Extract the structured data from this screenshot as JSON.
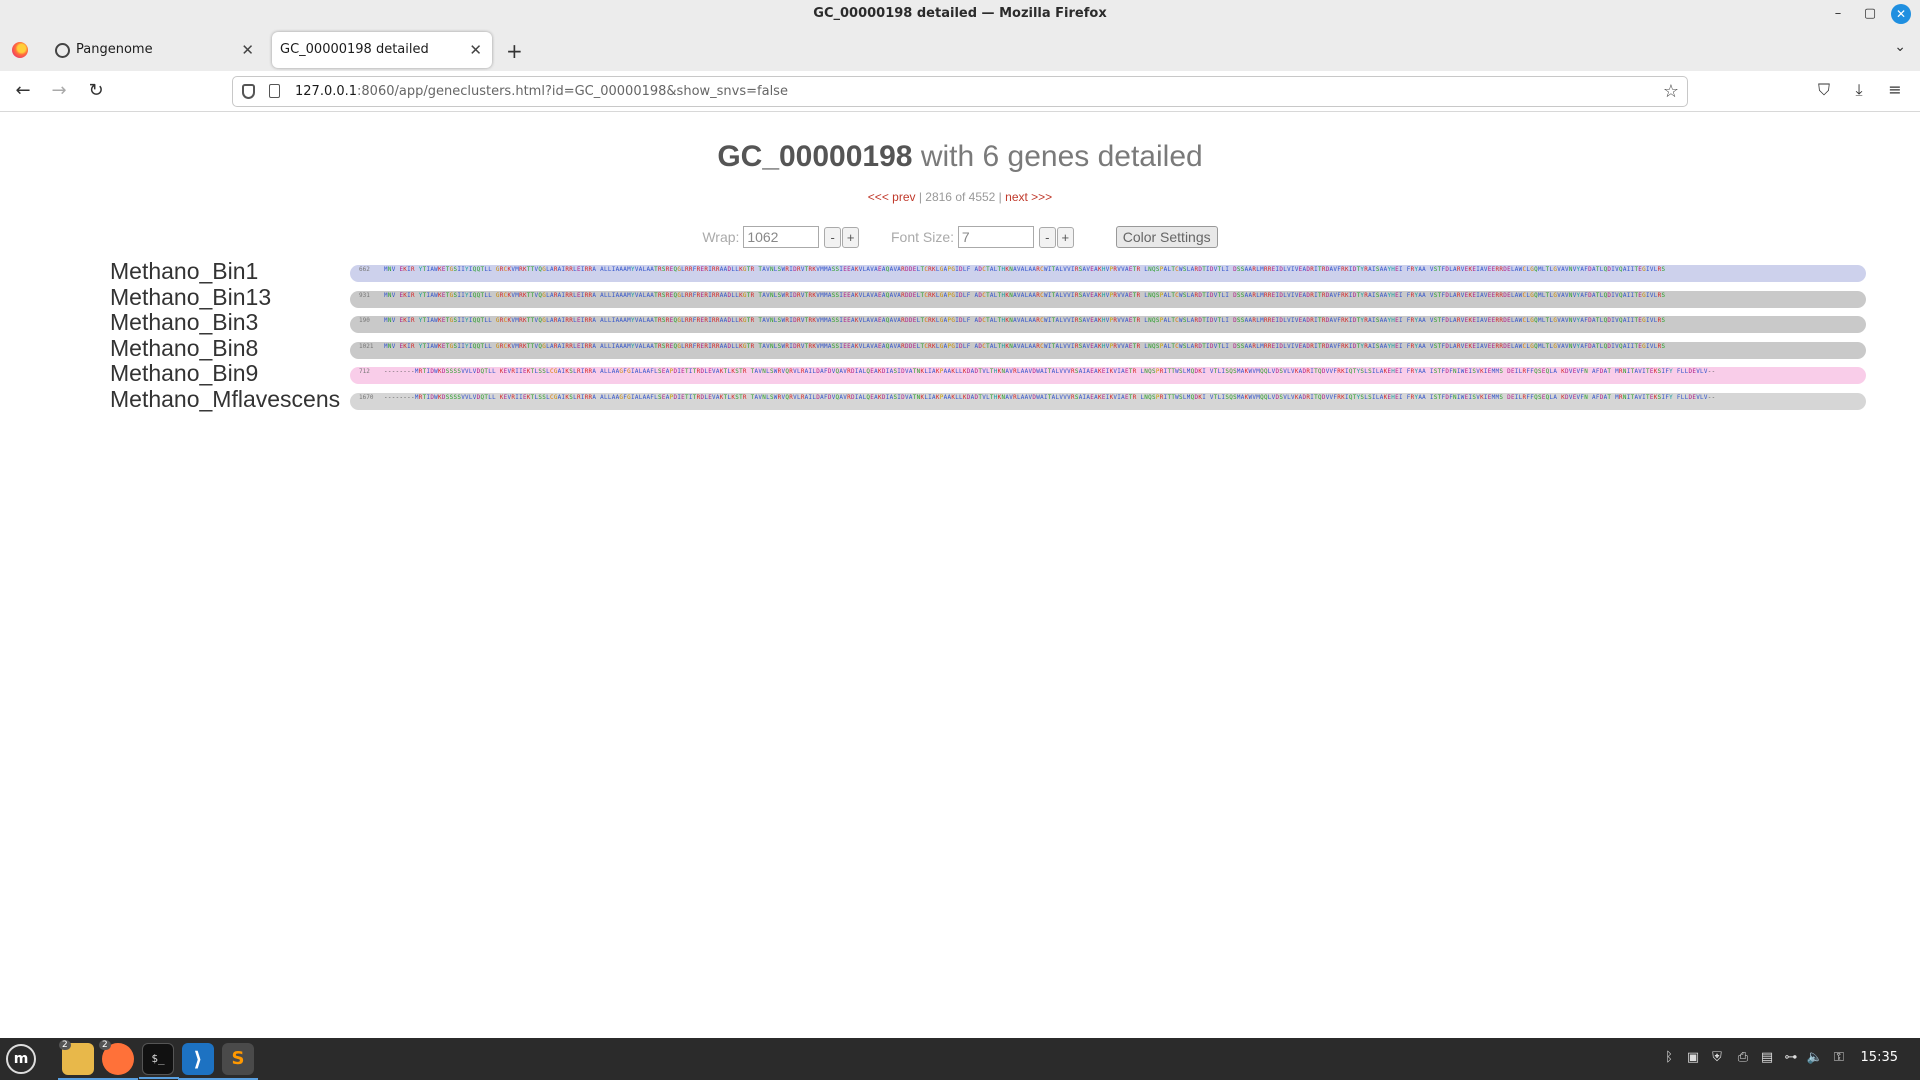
{
  "window": {
    "title": "GC_00000198 detailed — Mozilla Firefox",
    "minimize_glyph": "–",
    "maximize_glyph": "▢",
    "close_glyph": "✕"
  },
  "tabs": [
    {
      "label": "Pangenome",
      "close_glyph": "✕"
    },
    {
      "label": "GC_00000198 detailed",
      "close_glyph": "✕"
    }
  ],
  "tabstrip": {
    "new_tab_glyph": "+",
    "list_tabs_glyph": "⌄"
  },
  "nav": {
    "back_glyph": "←",
    "forward_glyph": "→",
    "reload_glyph": "↻",
    "url_host": "127.0.0.1",
    "url_rest": ":8060/app/geneclusters.html?id=GC_00000198&show_snvs=false",
    "bookmark_glyph": "☆",
    "pocket_glyph": "⛉",
    "downloads_glyph": "⤓",
    "menu_glyph": "≡"
  },
  "page": {
    "heading_id": "GC_00000198",
    "heading_rest": " with 6 genes detailed",
    "prev_label": "<<< prev",
    "pager_position": " | 2816 of 4552 | ",
    "next_label": "next >>>",
    "wrap_label": "Wrap:",
    "wrap_value": "1062",
    "font_size_label": "Font Size:",
    "font_size_value": "7",
    "minus_glyph": "-",
    "plus_glyph": "+",
    "color_settings_label": "Color Settings"
  },
  "genes": [
    {
      "name": "Methano_Bin1",
      "start": "662",
      "bar_color": "#cdd1ec",
      "sequence": "MNV EKIR YTIAWKETGSIIYIQQTLL GRCKVMRKTTVQGLARAIRRLEIRRA ALLIAAAMYVALAATRSREQGLRRFRERIRRAADLLKGTR TAVNLSWRIDRVTRKVMMASSIEEAKVLAVAEAQAVARDDELTCRKLGAPGIDLF ADCTALTHKNAVALAARCWITALVVIRSAVEAKHVPRVVAETR LNQSPALTCWSLARDTIDVTLI DSSAARLMRREIDLVIVEADRITRDAVFRKIDTYRAISAAYHEI FRYAA VSTFDLARVEKEIAVEERRDELAWCLGQMLTLGVAVNVYAFDATLQDIVQAIITEGIVLRS"
    },
    {
      "name": "Methano_Bin13",
      "start": "931",
      "bar_color": "#c9c9c9",
      "sequence": "MNV EKIR YTIAWKETGSIIYIQQTLL GRCKVMRKTTVQGLARAIRRLEIRRA ALLIAAAMYVALAATRSREQGLRRFRERIRRAADLLKGTR TAVNLSWRIDRVTRKVMMASSIEEAKVLAVAEAQAVARDDELTCRKLGAPGIDLF ADCTALTHKNAVALAARCWITALVVIRSAVEAKHVPRVVAETR LNQSPALTCWSLARDTIDVTLI DSSAARLMRREIDLVIVEADRITRDAVFRKIDTYRAISAAYHEI FRYAA VSTFDLARVEKEIAVEERRDELAWCLGQMLTLGVAVNVYAFDATLQDIVQAIITEGIVLRS"
    },
    {
      "name": "Methano_Bin3",
      "start": "190",
      "bar_color": "#c9c9c9",
      "sequence": "MNV EKIR YTIAWKETGSIIYIQQTLL GRCKVMRKTTVQGLARAIRRLEIRRA ALLIAAAMYVALAATRSREQGLRRFRERIRRAADLLKGTR TAVNLSWRIDRVTRKVMMASSIEEAKVLAVAEAQAVARDDELTCRKLGAPGIDLF ADCTALTHKNAVALAARCWITALVVIRSAVEAKHVPRVVAETR LNQSPALTCWSLARDTIDVTLI DSSAARLMRREIDLVIVEADRITRDAVFRKIDTYRAISAAYHEI FRYAA VSTFDLARVEKEIAVEERRDELAWCLGQMLTLGVAVNVYAFDATLQDIVQAIITEGIVLRS"
    },
    {
      "name": "Methano_Bin8",
      "start": "1021",
      "bar_color": "#c9c9c9",
      "sequence": "MNV EKIR YTIAWKETGSIIYIQQTLL GRCKVMRKTTVQGLARAIRRLEIRRA ALLIAAAMYVALAATRSREQGLRRFRERIRRAADLLKGTR TAVNLSWRIDRVTRKVMMASSIEEAKVLAVAEAQAVARDDELTCRKLGAPGIDLF ADCTALTHKNAVALAARCWITALVVIRSAVEAKHVPRVVAETR LNQSPALTCWSLARDTIDVTLI DSSAARLMRREIDLVIVEADRITRDAVFRKIDTYRAISAAYHEI FRYAA VSTFDLARVEKEIAVEERRDELAWCLGQMLTLGVAVNVYAFDATLQDIVQAIITEGIVLRS"
    },
    {
      "name": "Methano_Bin9",
      "start": "712",
      "bar_color": "#f9cde9",
      "sequence": "--------MRTIDWKDSSSSVVLVDQTLL KEVRIIEKTLSSLCGAIKSLRIRRA ALLAAGFGIALAAFLSEAPDIETITRDLEVAKTLKSTR TAVNLSWRVQRVLRAILDAFDVQAVRDIALQEAKDIASIDVATNKLIAKPAAKLLKDADTVLTHKNAVRLAAVDWAITALVVVRSAIAEAKEIKVIAETR LNQSPRITTWSLMQDKI VTLISQSMAKWVMQQLVDSVLVKADRITQDVVFRKIQTYSLSILAKEHEI FRYAA ISTFDFNIWEISVKIEMMS DEILRFFQSEQLA KDVEVFN AFDAT MRNITAVITEKSIFY FLLDEVLV--"
    },
    {
      "name": "Methano_Mflavescens",
      "start": "1670",
      "bar_color": "#d6d6d6",
      "sequence": "--------MRTIDWKDSSSSVVLVDQTLL KEVRIIEKTLSSLCGAIKSLRIRRA ALLAAGFGIALAAFLSEAPDIETITRDLEVAKTLKSTR TAVNLSWRVQRVLRAILDAFDVQAVRDIALQEAKDIASIDVATNKLIAKPAAKLLKDADTVLTHKNAVRLAAVDWAITALVVVRSAIAEAKEIKVIAETR LNQSPRITTWSLMQDKI VTLISQSMAKWVMQQLVDSVLVKADRITQDVVFRKIQTYSLSILAKEHEI FRYAA ISTFDFNIWEISVKIEMMS DEILRFFQSEQLA KDVEVFN AFDAT MRNITAVITEKSIFY FLLDEVLV--"
    }
  ],
  "taskbar": {
    "menu_glyph": "m",
    "files_badge": "2",
    "firefox_badge": "2",
    "terminal_glyph": "$_",
    "sublime_glyph": "S",
    "vscode_glyph": "⟩",
    "tray": [
      "ᛒ",
      "▣",
      "⛨",
      "⎙",
      "▤",
      "⊶",
      "🔈",
      "⚿"
    ],
    "clock": "15:35"
  },
  "colors": {
    "accent_link": "#c0392b",
    "close_button": "#1f8fe0",
    "taskbar_bg": "#2b2b2b"
  }
}
